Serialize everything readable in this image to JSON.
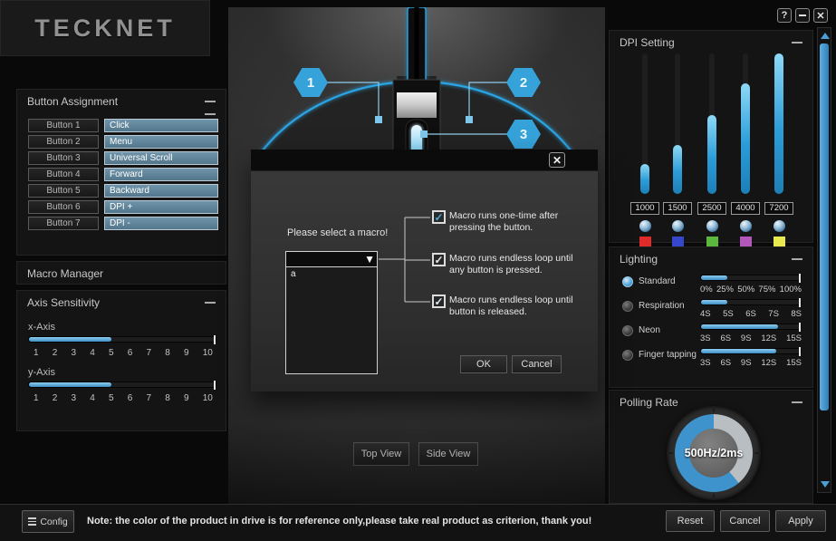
{
  "window": {
    "help_label": "?",
    "close_label": "✕"
  },
  "brand": {
    "logo": "TECKNET"
  },
  "button_assignment": {
    "title": "Button Assignment",
    "rows": [
      {
        "button": "Button 1",
        "action": "Click"
      },
      {
        "button": "Button 2",
        "action": "Menu"
      },
      {
        "button": "Button 3",
        "action": "Universal Scroll"
      },
      {
        "button": "Button 4",
        "action": "Forward"
      },
      {
        "button": "Button 5",
        "action": "Backward"
      },
      {
        "button": "Button 6",
        "action": "DPI +"
      },
      {
        "button": "Button 7",
        "action": "DPI -"
      }
    ]
  },
  "macro_manager": {
    "title": "Macro Manager"
  },
  "axis_sensitivity": {
    "title": "Axis Sensitivity",
    "x_axis": {
      "label": "x-Axis",
      "fill_pct": 44
    },
    "y_axis": {
      "label": "y-Axis",
      "fill_pct": 44
    },
    "ticks": [
      "1",
      "2",
      "3",
      "4",
      "5",
      "6",
      "7",
      "8",
      "9",
      "10"
    ]
  },
  "callouts": {
    "one": "1",
    "two": "2",
    "three": "3"
  },
  "macro_dialog": {
    "close_label": "✕",
    "prompt": "Please select a macro!",
    "combo_arrow": "▼",
    "selected_macro": "",
    "list_items": [
      "a"
    ],
    "options": [
      {
        "checked": true,
        "check_glyph": "✓",
        "check_color": "#4da6e0",
        "line1": "Macro runs one-time after",
        "line2": "pressing the button."
      },
      {
        "checked": true,
        "check_glyph": "✓",
        "check_color": "#dfe9ef",
        "line1": "Macro runs endless loop until",
        "line2": "any button is pressed."
      },
      {
        "checked": true,
        "check_glyph": "✓",
        "check_color": "#dfe9ef",
        "line1": "Macro runs endless loop until",
        "line2": "button is released."
      }
    ],
    "ok_label": "OK",
    "cancel_label": "Cancel"
  },
  "view_buttons": {
    "top": "Top View",
    "side": "Side View"
  },
  "dpi": {
    "title": "DPI Setting",
    "levels": [
      {
        "value": "1000",
        "fill_pct": 21,
        "color": "#e02b2b"
      },
      {
        "value": "1500",
        "fill_pct": 35,
        "color": "#3547cd"
      },
      {
        "value": "2500",
        "fill_pct": 56,
        "color": "#5cb73f"
      },
      {
        "value": "4000",
        "fill_pct": 79,
        "color": "#b457ba"
      },
      {
        "value": "7200",
        "fill_pct": 100,
        "color": "#e8e84f"
      }
    ]
  },
  "lighting": {
    "title": "Lighting",
    "modes": [
      {
        "label": "Standard",
        "selected": true,
        "fill_pct": 26,
        "ticks": [
          "0%",
          "25%",
          "50%",
          "75%",
          "100%"
        ]
      },
      {
        "label": "Respiration",
        "selected": false,
        "fill_pct": 26,
        "ticks": [
          "4S",
          "5S",
          "6S",
          "7S",
          "8S"
        ]
      },
      {
        "label": "Neon",
        "selected": false,
        "fill_pct": 77,
        "ticks": [
          "3S",
          "6S",
          "9S",
          "12S",
          "15S"
        ]
      },
      {
        "label": "Finger tapping",
        "selected": false,
        "fill_pct": 75,
        "ticks": [
          "3S",
          "6S",
          "9S",
          "12S",
          "15S"
        ]
      }
    ]
  },
  "polling": {
    "title": "Polling Rate",
    "value": "500Hz/2ms",
    "gray_color": "#b9bec2",
    "blue_color": "#3f93cc",
    "gray_to_deg": 140
  },
  "footer": {
    "config_label": "Config",
    "note": "Note: the color of the product in drive is for reference only,please take real product as criterion, thank you!",
    "reset_label": "Reset",
    "cancel_label": "Cancel",
    "apply_label": "Apply"
  }
}
